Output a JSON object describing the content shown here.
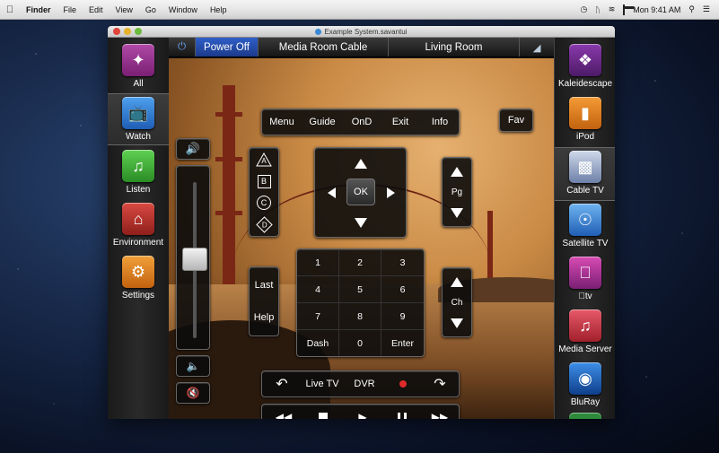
{
  "menubar": {
    "app": "Finder",
    "items": [
      "File",
      "Edit",
      "View",
      "Go",
      "Window",
      "Help"
    ],
    "clock": "Mon 9:41 AM"
  },
  "window": {
    "title": "Example System.savantui"
  },
  "left_sidebar": {
    "items": [
      {
        "label": "All",
        "icon": "compass-icon",
        "color": "#8e2f86"
      },
      {
        "label": "Watch",
        "icon": "tv-icon",
        "color": "#2f7fd6",
        "selected": true
      },
      {
        "label": "Listen",
        "icon": "music-note-icon",
        "color": "#3fae35"
      },
      {
        "label": "Environment",
        "icon": "house-icon",
        "color": "#b8312c"
      },
      {
        "label": "Settings",
        "icon": "gears-icon",
        "color": "#d97a1c"
      }
    ]
  },
  "right_sidebar": {
    "items": [
      {
        "label": "Kaleidescape",
        "icon": "kaleidescape-icon",
        "color": "#6b2a8a"
      },
      {
        "label": "iPod",
        "icon": "ipod-icon",
        "color": "#e07b1e"
      },
      {
        "label": "Cable TV",
        "icon": "remote-icon",
        "color": "#7b8fb5",
        "selected": true
      },
      {
        "label": "Satellite TV",
        "icon": "satellite-dish-icon",
        "color": "#3a7fc9"
      },
      {
        "label": "tv",
        "icon": "apple-tv-icon",
        "color": "#b02a8f"
      },
      {
        "label": "Media Server",
        "icon": "media-server-icon",
        "color": "#c8343c"
      },
      {
        "label": "BluRay",
        "icon": "bluray-icon",
        "color": "#1d5fb8"
      }
    ]
  },
  "topbar": {
    "power_off": "Power Off",
    "room_source": "Media Room Cable",
    "location": "Living Room"
  },
  "menu_bar_buttons": [
    "Menu",
    "Guide",
    "OnD",
    "Exit",
    "Info"
  ],
  "fav": "Fav",
  "abcd": [
    "A",
    "B",
    "C",
    "D"
  ],
  "dpad": {
    "ok": "OK"
  },
  "page": {
    "label": "Pg"
  },
  "channel": {
    "label": "Ch"
  },
  "last_help": {
    "last": "Last",
    "help": "Help"
  },
  "keypad": [
    "1",
    "2",
    "3",
    "4",
    "5",
    "6",
    "7",
    "8",
    "9",
    "Dash",
    "0",
    "Enter"
  ],
  "dvr_bar": {
    "live_tv": "Live TV",
    "dvr": "DVR"
  },
  "volume": {
    "level": 0.55
  }
}
